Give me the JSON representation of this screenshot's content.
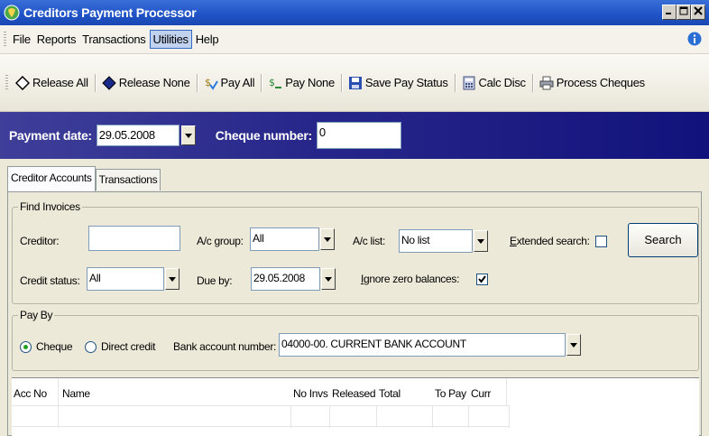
{
  "window": {
    "title": "Creditors Payment Processor"
  },
  "menu": [
    {
      "label": "File"
    },
    {
      "label": "Reports"
    },
    {
      "label": "Transactions"
    },
    {
      "label": "Utilities",
      "active": true
    },
    {
      "label": "Help"
    }
  ],
  "toolbar": {
    "release_all": "Release All",
    "release_none": "Release None",
    "pay_all": "Pay All",
    "pay_none": "Pay None",
    "save_pay_status": "Save Pay Status",
    "calc_disc": "Calc Disc",
    "process_cheques": "Process Cheques"
  },
  "header": {
    "payment_date_label": "Payment date:",
    "payment_date_value": "29.05.2008",
    "cheque_number_label": "Cheque number:",
    "cheque_number_value": "0"
  },
  "tabs": [
    {
      "label": "Creditor Accounts",
      "active": true
    },
    {
      "label": "Transactions",
      "active": false
    }
  ],
  "find_invoices": {
    "title": "Find Invoices",
    "creditor_label": "Creditor:",
    "creditor_value": "",
    "ac_group_label": "A/c group:",
    "ac_group_value": "All",
    "ac_list_label": "A/c list:",
    "ac_list_value": "No list",
    "extended_search_label": "Extended search:",
    "extended_search_checked": false,
    "search_button": "Search",
    "credit_status_label": "Credit status:",
    "credit_status_value": "All",
    "due_by_label": "Due by:",
    "due_by_value": "29.05.2008",
    "ignore_zero_label": "Ignore zero balances:",
    "ignore_zero_checked": true
  },
  "pay_by": {
    "title": "Pay By",
    "cheque_label": "Cheque",
    "direct_credit_label": "Direct credit",
    "selected": "cheque",
    "bank_account_label": "Bank account number:",
    "bank_account_value": "04000-00. CURRENT BANK ACCOUNT"
  },
  "grid": {
    "columns": [
      "Acc No",
      "Name",
      "No Invs",
      "Released",
      "Total",
      "To Pay",
      "Curr"
    ]
  },
  "colors": {
    "title_bar": "#1f52c6",
    "header_band": "#26268a",
    "radio_dot": "#21a121"
  }
}
